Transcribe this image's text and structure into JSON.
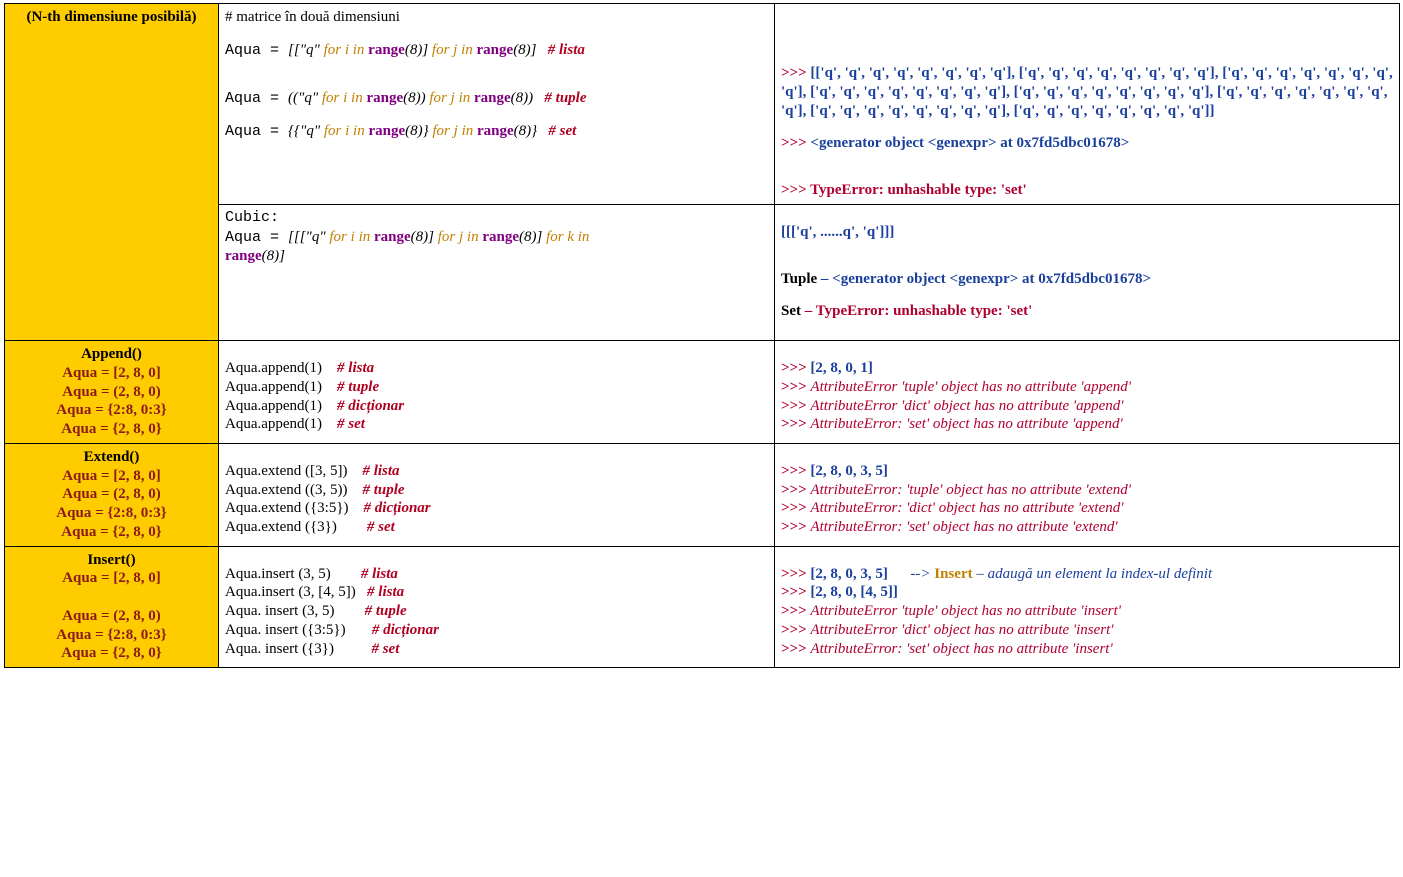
{
  "ndim": {
    "label": "(N-th dimensiune posibilă)",
    "title": "# matrice în două dimensiuni",
    "lista_line": {
      "pre": "Aqua = ",
      "open": "[[",
      "q": "\"q\"",
      "for1": " for i in ",
      "range": "range",
      "arg": "(8)",
      "close1": "]",
      "for2": " for j in ",
      "close2": "(8)]",
      "comment": "# lista"
    },
    "tuple_line": {
      "pre": "Aqua = ",
      "open": "((",
      "q": "\"q\"",
      "for1": " for i in ",
      "range": "range",
      "arg": "(8)",
      "close1": ")",
      "for2": " for j in ",
      "close2": "(8))",
      "comment": "# tuple"
    },
    "set_line": {
      "pre": "Aqua = ",
      "open": "{{",
      "q": "\"q\"",
      "for1": " for i in ",
      "range": "range",
      "arg": "(8)",
      "close1": "}",
      "for2": " for j in ",
      "close2": "(8)}",
      "comment": "# set"
    },
    "out_list_prompt": ">>> ",
    "out_list": "[['q', 'q', 'q', 'q', 'q', 'q', 'q', 'q'], ['q', 'q', 'q', 'q', 'q', 'q', 'q', 'q'], ['q', 'q', 'q', 'q', 'q', 'q', 'q', 'q'], ['q', 'q', 'q', 'q', 'q', 'q', 'q', 'q'], ['q', 'q', 'q', 'q', 'q', 'q', 'q', 'q'], ['q', 'q', 'q', 'q', 'q', 'q', 'q', 'q'], ['q', 'q', 'q', 'q', 'q', 'q', 'q', 'q'], ['q', 'q', 'q', 'q', 'q', 'q', 'q', 'q']]",
    "out_gen_prompt": ">>> ",
    "out_gen": "<generator object <genexpr> at 0x7fd5dbc01678>",
    "out_err_prompt": ">>> ",
    "out_err": "TypeError: unhashable type: 'set'",
    "cubic_title": "Cubic:",
    "cubic_line": {
      "pre": "Aqua = ",
      "open": "[[[",
      "q": "\"q\"",
      "for1": " for i in ",
      "range": "range",
      "arg": "(8)",
      "close1": "]",
      "for2": " for j in ",
      "close2": "(8)]",
      "for3": " for k in ",
      "close3": "(8)]"
    },
    "cubic_out1": "[[['q', ......q', 'q']]]",
    "cubic_tuple_label": "Tuple",
    "cubic_tuple_sep": " – ",
    "cubic_tuple_val": "<generator object <genexpr> at 0x7fd5dbc01678>",
    "cubic_set_label": "Set",
    "cubic_set_sep": " – ",
    "cubic_set_val": "TypeError: unhashable type: 'set'"
  },
  "append": {
    "title": "Append()",
    "defs": [
      "Aqua = [2, 8, 0]",
      "Aqua = (2, 8, 0)",
      "Aqua = {2:8, 0:3}",
      "Aqua = {2, 8, 0}"
    ],
    "code": [
      "Aqua.append(1)",
      "Aqua.append(1)",
      "Aqua.append(1)",
      "Aqua.append(1)"
    ],
    "comments": [
      "# lista",
      "# tuple",
      "# dicționar",
      "# set"
    ],
    "out_ok": "[2, 8, 0, 1]",
    "errs": [
      "AttributeError 'tuple' object has no attribute 'append'",
      "AttributeError 'dict' object has no attribute 'append'",
      "AttributeError: 'set' object has no attribute 'append'"
    ]
  },
  "extend": {
    "title": "Extend()",
    "defs": [
      "Aqua = [2, 8, 0]",
      "Aqua = (2, 8, 0)",
      "Aqua = {2:8, 0:3}",
      "Aqua = {2, 8, 0}"
    ],
    "code": [
      "Aqua.extend ([3, 5])",
      "Aqua.extend ((3, 5))",
      "Aqua.extend ({3:5})",
      "Aqua.extend ({3})"
    ],
    "comments": [
      "# lista",
      "# tuple",
      "# dicționar",
      "# set"
    ],
    "out_ok": "[2, 8, 0, 3, 5]",
    "errs": [
      "AttributeError: 'tuple' object has no attribute 'extend'",
      "AttributeError: 'dict' object has no attribute 'extend'",
      "AttributeError: 'set' object has no attribute 'extend'"
    ]
  },
  "insert": {
    "title": "Insert()",
    "defs": [
      "Aqua = [2, 8, 0]",
      "",
      "Aqua = (2, 8, 0)",
      "Aqua = {2:8, 0:3}",
      "Aqua = {2, 8, 0}"
    ],
    "code": [
      "Aqua.insert (3, 5)",
      "Aqua.insert (3, [4, 5])",
      "Aqua. insert (3, 5)",
      "Aqua. insert ({3:5})",
      "Aqua. insert ({3})"
    ],
    "comments": [
      "# lista",
      "# lista",
      "# tuple",
      "# dicționar",
      "# set"
    ],
    "out1": "[2, 8, 0, 3, 5]",
    "out1_note_arrow": "--> ",
    "out1_note_kw": "Insert",
    "out1_note_sep": " – ",
    "out1_note_txt": "adaugă un element la index-ul definit",
    "out2": "[2, 8, 0, [4, 5]]",
    "errs": [
      "AttributeError 'tuple' object has no attribute 'insert'",
      "AttributeError 'dict' object has no attribute 'insert'",
      "AttributeError: 'set' object has no attribute 'insert'"
    ]
  },
  "prompt": ">>> "
}
